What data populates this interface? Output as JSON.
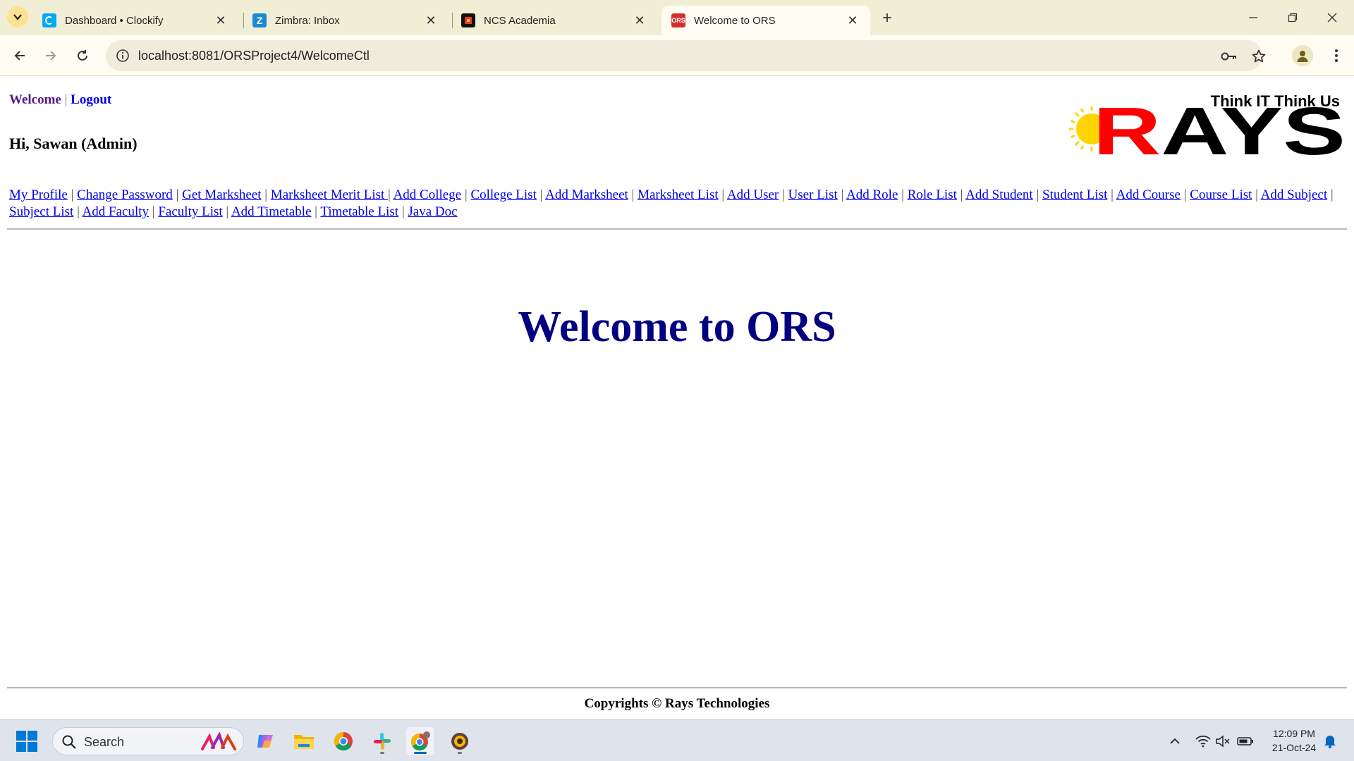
{
  "browser": {
    "tabs": [
      {
        "title": "Dashboard • Clockify",
        "favicon": "clockify-icon",
        "color": "#03a9f4",
        "active": false
      },
      {
        "title": "Zimbra: Inbox",
        "favicon": "zimbra-icon",
        "color": "#1a8ad4",
        "active": false
      },
      {
        "title": "NCS Academia",
        "favicon": "ncs-icon",
        "color": "#111111",
        "active": false
      },
      {
        "title": "Welcome to ORS",
        "favicon": "ors-icon",
        "favicon_text": "ORS",
        "color": "#d32f2f",
        "active": true
      }
    ],
    "url": "localhost:8081/ORSProject4/WelcomeCtl"
  },
  "page": {
    "header": {
      "welcome": "Welcome",
      "separator": "|",
      "logout": "Logout",
      "greeting": "Hi, Sawan (Admin)"
    },
    "logo": {
      "tagline": "Think IT Think Us",
      "brand_r": "R",
      "brand_rest": "AYS"
    },
    "menu": [
      "My Profile",
      "Change Password",
      "Get Marksheet",
      "Marksheet Merit List ",
      "Add College",
      "College List",
      "Add Marksheet",
      "Marksheet List",
      "Add User",
      "User List",
      "Add Role",
      "Role List",
      "Add Student",
      "Student List",
      "Add Course",
      "Course List",
      "Add Subject",
      "Subject List",
      "Add Faculty",
      "Faculty List",
      "Add Timetable",
      "Timetable List",
      "Java Doc"
    ],
    "heading": "Welcome to ORS",
    "footer": "Copyrights © Rays Technologies"
  },
  "taskbar": {
    "search_placeholder": "Search",
    "time": "12:09 PM",
    "date": "21-Oct-24"
  },
  "colors": {
    "tabbar": "#f1eed6",
    "heading": "#000080",
    "link": "#0000ee",
    "visited_link": "#551a8b"
  }
}
